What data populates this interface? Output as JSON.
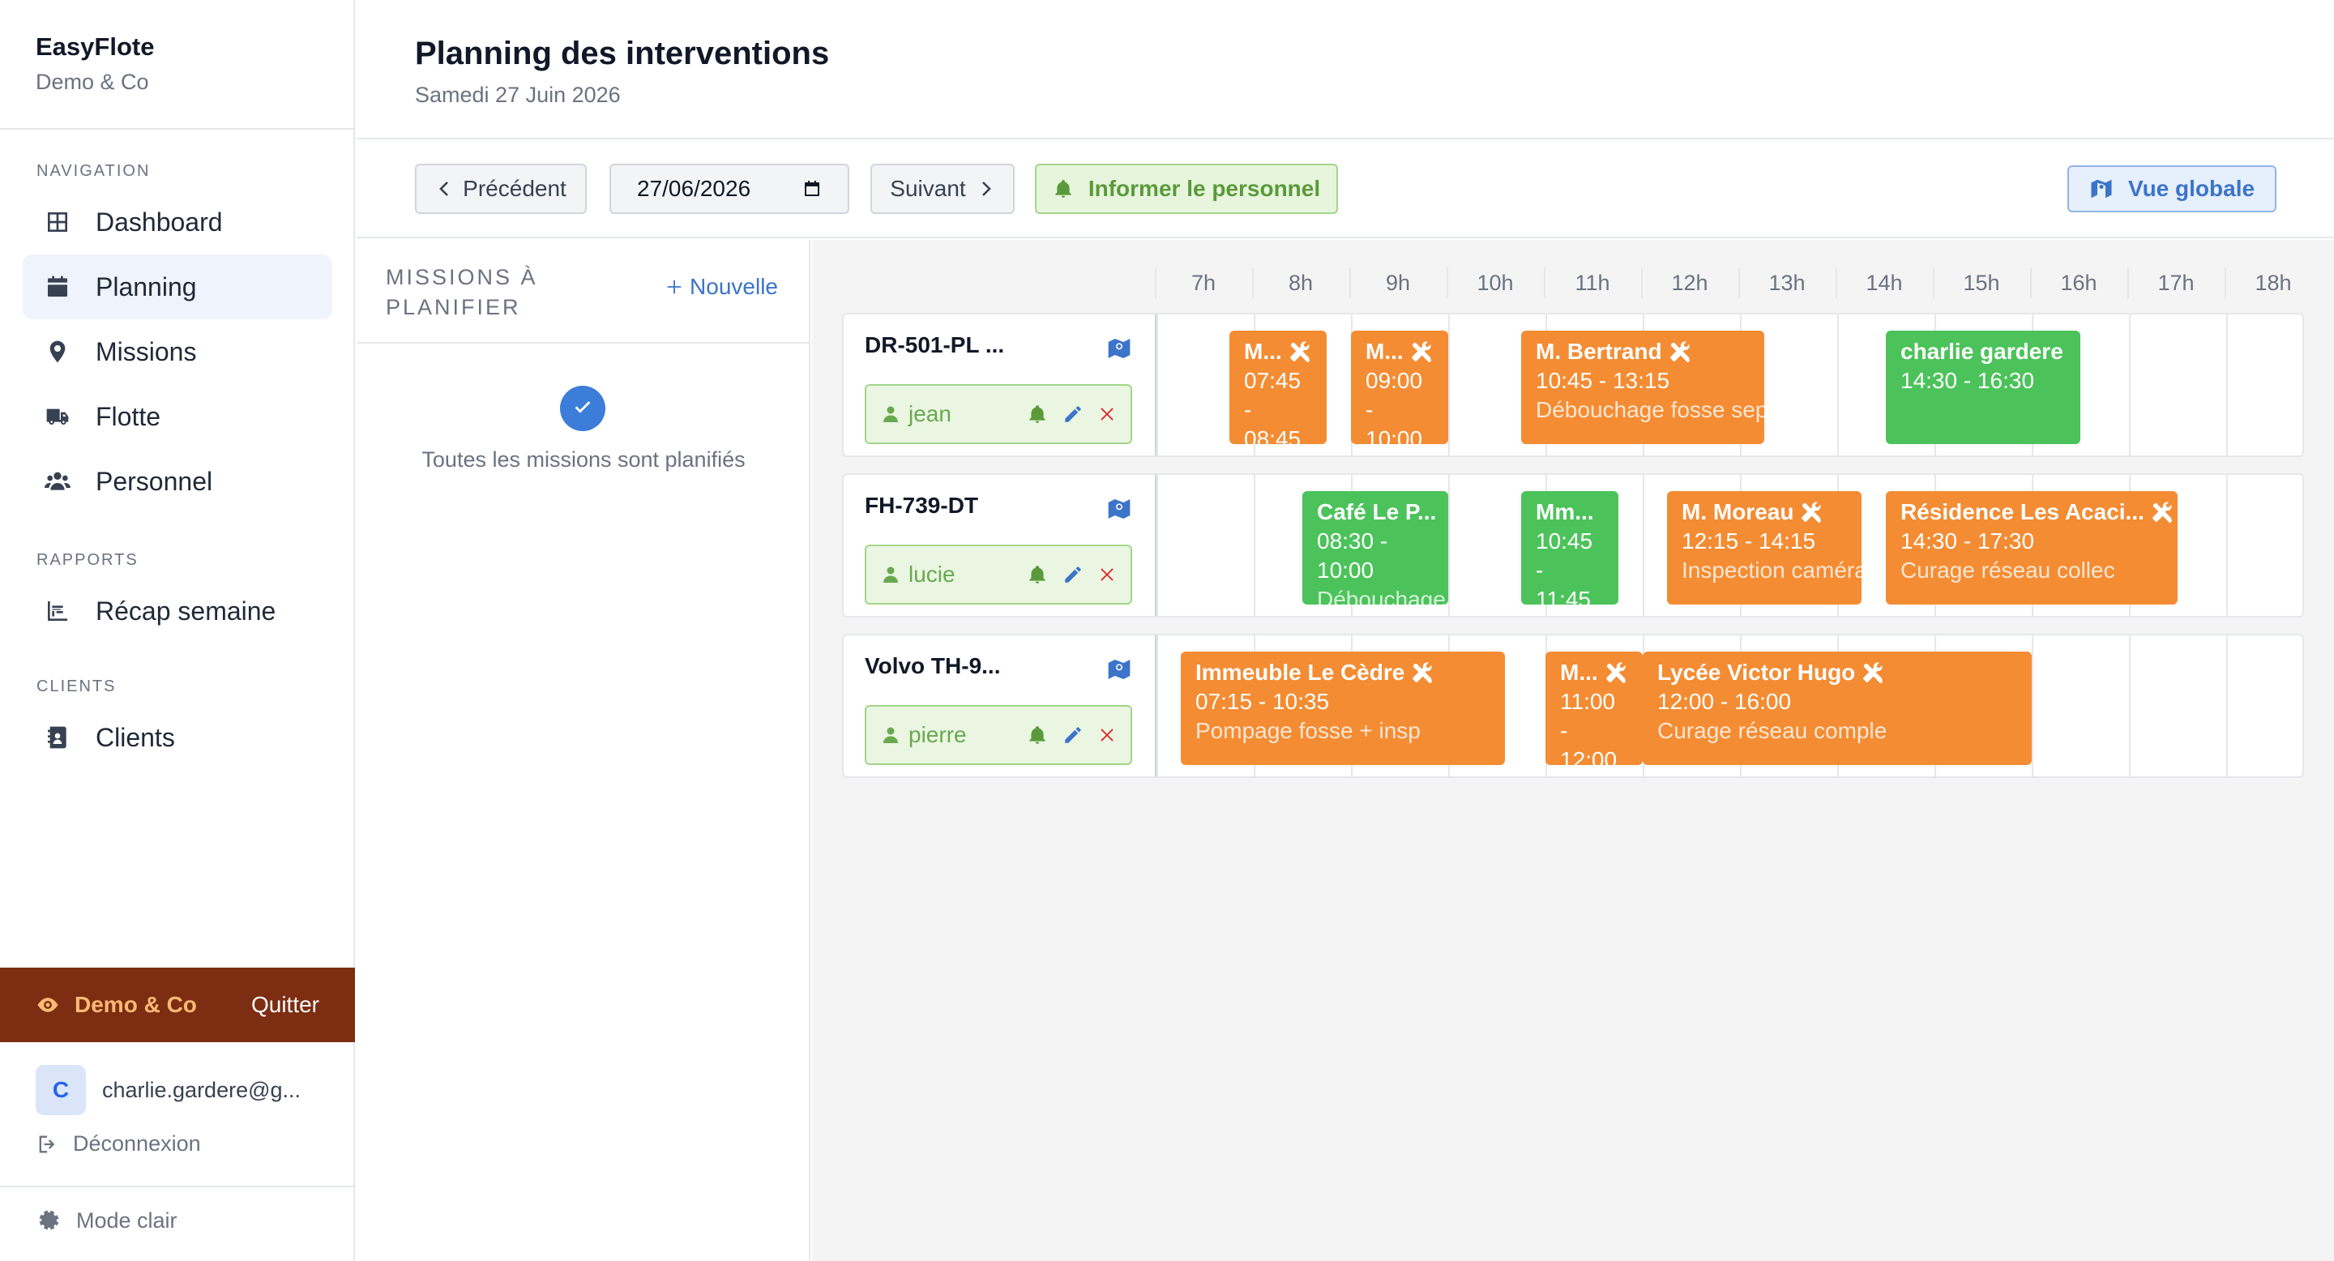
{
  "sidebar": {
    "brand_title": "EasyFlote",
    "brand_subtitle": "Demo & Co",
    "sections": {
      "navigation": "NAVIGATION",
      "rapports": "RAPPORTS",
      "clients": "CLIENTS"
    },
    "items": {
      "dashboard": "Dashboard",
      "planning": "Planning",
      "missions": "Missions",
      "flotte": "Flotte",
      "personnel": "Personnel",
      "recap": "Récap semaine",
      "clients": "Clients"
    },
    "active_item": "Planning",
    "impersonation": {
      "label": "Demo & Co",
      "quit": "Quitter",
      "bar_color": "#7c2d12"
    },
    "user": {
      "initial": "C",
      "email": "charlie.gardere@g..."
    },
    "logout": "Déconnexion",
    "theme_toggle": "Mode clair"
  },
  "header": {
    "title": "Planning des interventions",
    "date": "Samedi 27 Juin 2026"
  },
  "toolbar": {
    "prev": "Précédent",
    "date_value": "27/06/2026",
    "next": "Suivant",
    "notify": "Informer le personnel",
    "global_view": "Vue globale"
  },
  "missions_panel": {
    "title": "MISSIONS À PLANIFIER",
    "new_button": "Nouvelle",
    "empty_text": "Toutes les missions sont planifiés"
  },
  "timeline": {
    "hours": [
      "7h",
      "8h",
      "9h",
      "10h",
      "11h",
      "12h",
      "13h",
      "14h",
      "15h",
      "16h",
      "17h",
      "18h"
    ],
    "rows": [
      {
        "vehicle": "DR-501-PL ...",
        "driver": "jean",
        "events": [
          {
            "title": "M...",
            "time": "07:45 - 08:45",
            "desc": "",
            "start": 7.75,
            "end": 8.75,
            "color": "orange",
            "tool": true
          },
          {
            "title": "M...",
            "time": "09:00 - 10:00",
            "desc": "",
            "start": 9.0,
            "end": 10.0,
            "color": "orange",
            "tool": true
          },
          {
            "title": "M. Bertrand",
            "time": "10:45 - 13:15",
            "desc": "Débouchage fosse sep",
            "start": 10.75,
            "end": 13.25,
            "color": "orange",
            "tool": true
          },
          {
            "title": "charlie gardere",
            "time": "14:30 - 16:30",
            "desc": "",
            "start": 14.5,
            "end": 16.5,
            "color": "green",
            "tool": false
          }
        ]
      },
      {
        "vehicle": "FH-739-DT",
        "driver": "lucie",
        "events": [
          {
            "title": "Café Le P...",
            "time": "08:30 - 10:00",
            "desc": "Débouchage",
            "start": 8.5,
            "end": 10.0,
            "color": "green",
            "tool": false
          },
          {
            "title": "Mm...",
            "time": "10:45 - 11:45",
            "desc": "",
            "start": 10.75,
            "end": 11.75,
            "color": "green",
            "tool": false
          },
          {
            "title": "M. Moreau",
            "time": "12:15 - 14:15",
            "desc": "Inspection caméra +",
            "start": 12.25,
            "end": 14.25,
            "color": "orange",
            "tool": true
          },
          {
            "title": "Résidence Les Acaci...",
            "time": "14:30 - 17:30",
            "desc": "Curage réseau collec",
            "start": 14.5,
            "end": 17.5,
            "color": "orange",
            "tool": true
          }
        ]
      },
      {
        "vehicle": "Volvo TH-9...",
        "driver": "pierre",
        "events": [
          {
            "title": "Immeuble Le Cèdre",
            "time": "07:15 - 10:35",
            "desc": "Pompage fosse + insp",
            "start": 7.25,
            "end": 10.583,
            "color": "orange",
            "tool": true
          },
          {
            "title": "M...",
            "time": "11:00 - 12:00",
            "desc": "",
            "start": 11.0,
            "end": 12.0,
            "color": "orange",
            "tool": true
          },
          {
            "title": "Lycée Victor Hugo",
            "time": "12:00 - 16:00",
            "desc": "Curage réseau comple",
            "start": 12.0,
            "end": 16.0,
            "color": "orange",
            "tool": true
          }
        ]
      }
    ]
  },
  "colors": {
    "event_orange": "#f48c33",
    "event_green": "#4bc35a",
    "accent_blue": "#3b74c9",
    "notify_green": "#5a9a3a"
  }
}
